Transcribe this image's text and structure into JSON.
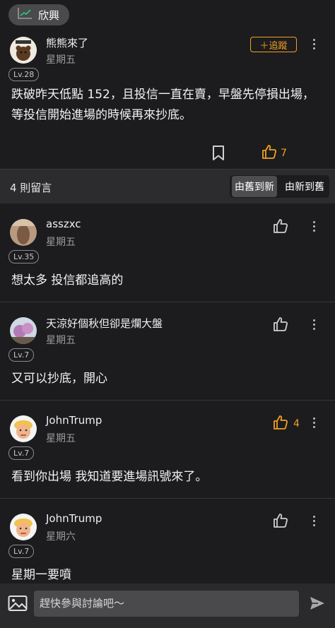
{
  "header": {
    "stock_chip_label": "欣興"
  },
  "post": {
    "author": "熊熊來了",
    "date": "星期五",
    "level": "Lv.28",
    "follow_label": "＋追蹤",
    "body": "跌破昨天低點 152，且投信一直在賣，早盤先停損出場，等投信開始進場的時候再來抄底。",
    "likes": "7"
  },
  "comments_bar": {
    "count_label": "4 則留言",
    "sort_options": [
      "由舊到新",
      "由新到舊"
    ],
    "active_sort": "由舊到新"
  },
  "comments": [
    {
      "author": "asszxc",
      "date": "星期五",
      "level": "Lv.35",
      "text": "想太多 投信都追高的",
      "likes": ""
    },
    {
      "author": "天涼好個秋但卻是爛大盤",
      "date": "星期五",
      "level": "Lv.7",
      "text": "又可以抄底，開心",
      "likes": ""
    },
    {
      "author": "JohnTrump",
      "date": "星期五",
      "level": "Lv.7",
      "text": "看到你出場 我知道要進場訊號來了。",
      "likes": "4"
    },
    {
      "author": "JohnTrump",
      "date": "星期六",
      "level": "Lv.7",
      "text": "星期一要噴",
      "likes": ""
    }
  ],
  "composer": {
    "placeholder": "趕快參與討論吧～"
  },
  "colors": {
    "accent": "#f0a020",
    "background": "#1c1c1e",
    "bar": "#2c2c2e"
  },
  "icons": [
    "chart-line-icon",
    "bookmark-icon",
    "thumb-up-icon",
    "more-vertical-icon",
    "image-icon",
    "send-icon"
  ]
}
